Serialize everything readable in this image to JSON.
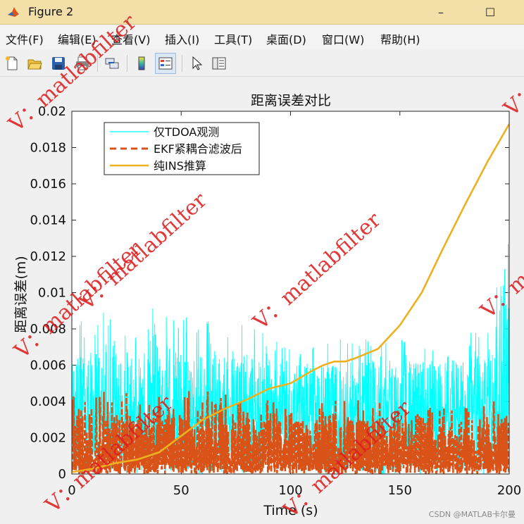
{
  "window": {
    "title": "Figure 2",
    "minimize_glyph": "–",
    "maximize_glyph": "☐"
  },
  "menu": [
    "文件(F)",
    "编辑(E)",
    "查看(V)",
    "插入(I)",
    "工具(T)",
    "桌面(D)",
    "窗口(W)",
    "帮助(H)"
  ],
  "toolbar_icons": [
    "new-file-icon",
    "open-folder-icon",
    "save-icon",
    "print-icon",
    "link-icon",
    "colorbar-icon",
    "legend-icon",
    "pointer-icon",
    "property-inspector-icon"
  ],
  "watermark_text": "V：matlabfilter",
  "credit": "CSDN @MATLAB卡尔曼",
  "chart_data": {
    "type": "line",
    "title": "距离误差对比",
    "xlabel": "Time (s)",
    "ylabel": "距离误差(m)",
    "xlim": [
      0,
      200
    ],
    "ylim": [
      0,
      0.02
    ],
    "xticks": [
      0,
      50,
      100,
      150,
      200
    ],
    "yticks": [
      0,
      0.002,
      0.004,
      0.006,
      0.008,
      0.01,
      0.012,
      0.014,
      0.016,
      0.018,
      0.02
    ],
    "ytick_labels": [
      "0",
      "0.002",
      "0.004",
      "0.006",
      "0.008",
      "0.01",
      "0.012",
      "0.014",
      "0.016",
      "0.018",
      "0.02"
    ],
    "grid": false,
    "legend_position": "top-left",
    "series": [
      {
        "name": "仅TDOA观测",
        "color": "#00ffff",
        "style": "solid",
        "noise_envelope": {
          "x": [
            0,
            10,
            20,
            30,
            40,
            50,
            60,
            70,
            80,
            90,
            100,
            110,
            120,
            130,
            140,
            150,
            160,
            170,
            180,
            190,
            195,
            200
          ],
          "typical_max": [
            0.0065,
            0.0068,
            0.0068,
            0.0068,
            0.0068,
            0.0068,
            0.0068,
            0.0068,
            0.0066,
            0.0062,
            0.006,
            0.006,
            0.006,
            0.0063,
            0.0063,
            0.0062,
            0.0063,
            0.0062,
            0.0064,
            0.0068,
            0.0085,
            0.012
          ],
          "peak_max": [
            0.0098,
            0.009,
            0.0088,
            0.0092,
            0.0094,
            0.0088,
            0.0087,
            0.0093,
            0.0086,
            0.0075,
            0.0074,
            0.0072,
            0.0078,
            0.0072,
            0.0085,
            0.0075,
            0.0074,
            0.0068,
            0.0082,
            0.0092,
            0.0108,
            0.0135
          ],
          "dense_floor": [
            0.0025,
            0.0025,
            0.0025,
            0.0025,
            0.0025,
            0.0025,
            0.0025,
            0.0025,
            0.0025,
            0.0025,
            0.0025,
            0.0025,
            0.0025,
            0.0025,
            0.0025,
            0.0025,
            0.0025,
            0.0025,
            0.0025,
            0.0025,
            0.0025,
            0.0025
          ]
        }
      },
      {
        "name": "EKF紧耦合滤波后",
        "color": "#d95319",
        "style": "dashed",
        "noise_envelope": {
          "x": [
            0,
            20,
            40,
            60,
            80,
            100,
            120,
            140,
            160,
            180,
            200
          ],
          "typical_max": [
            0.0033,
            0.0033,
            0.0032,
            0.0032,
            0.0031,
            0.003,
            0.003,
            0.003,
            0.003,
            0.003,
            0.0034
          ],
          "peak_max": [
            0.0048,
            0.0046,
            0.0045,
            0.0046,
            0.0043,
            0.0038,
            0.0041,
            0.0041,
            0.0038,
            0.0038,
            0.0043
          ],
          "dense_floor": [
            0.0005,
            0.0005,
            0.0005,
            0.0005,
            0.0005,
            0.0005,
            0.0005,
            0.0005,
            0.0005,
            0.0005,
            0.0005
          ]
        }
      },
      {
        "name": "纯INS推算",
        "color": "#edb120",
        "style": "solid",
        "x": [
          0,
          10,
          20,
          30,
          40,
          50,
          60,
          70,
          80,
          90,
          100,
          110,
          115,
          120,
          125,
          130,
          140,
          150,
          160,
          170,
          180,
          190,
          200
        ],
        "y": [
          0.0001,
          0.0003,
          0.0006,
          0.0008,
          0.0012,
          0.0021,
          0.003,
          0.0036,
          0.0041,
          0.0047,
          0.005,
          0.0057,
          0.006,
          0.0062,
          0.0062,
          0.0064,
          0.0069,
          0.0082,
          0.01,
          0.0125,
          0.0149,
          0.0172,
          0.0193
        ]
      }
    ]
  }
}
